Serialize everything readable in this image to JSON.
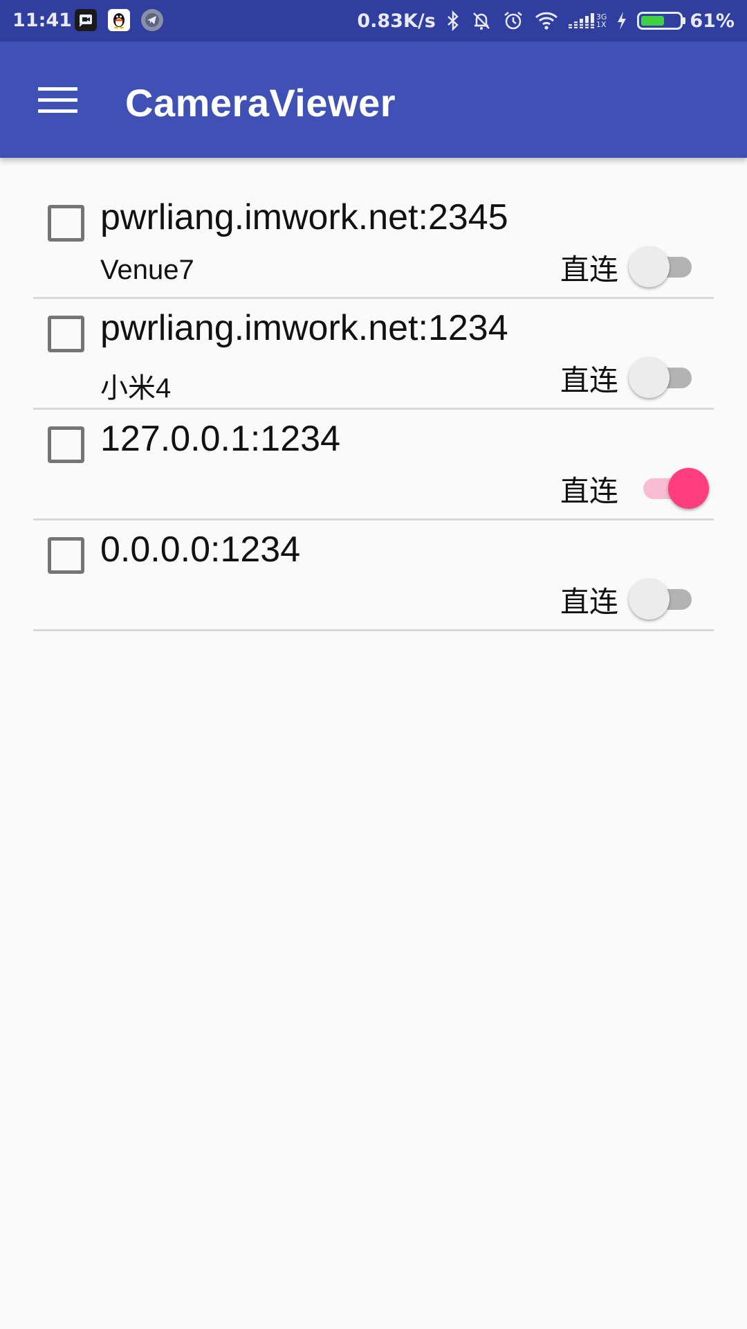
{
  "status_bar": {
    "time": "11:41",
    "notification_icons": [
      "video-message-icon",
      "qq-penguin-icon",
      "telegram-icon"
    ],
    "net_speed": "0.83K/s",
    "status_icons": [
      "bluetooth-icon",
      "bell-off-icon",
      "alarm-icon",
      "wifi-icon",
      "cellular-signal-icon",
      "charging-icon"
    ],
    "network_type_top": "3G",
    "network_type_bottom": "1X",
    "battery_percent": "61%",
    "battery_level": 0.61,
    "battery_color": "#3fd13f"
  },
  "app_bar": {
    "title": "CameraViewer",
    "menu_icon": "hamburger-menu-icon",
    "background_color": "#3f51b5"
  },
  "devices": [
    {
      "address": "pwrliang.imwork.net:2345",
      "name": "Venue7",
      "switch_label": "直连",
      "direct": false,
      "checked": false
    },
    {
      "address": "pwrliang.imwork.net:1234",
      "name": "小米4",
      "switch_label": "直连",
      "direct": false,
      "checked": false
    },
    {
      "address": "127.0.0.1:1234",
      "name": "",
      "switch_label": "直连",
      "direct": true,
      "checked": false
    },
    {
      "address": "0.0.0.0:1234",
      "name": "",
      "switch_label": "直连",
      "direct": false,
      "checked": false
    }
  ],
  "colors": {
    "status_bar": "#303f9f",
    "switch_on": "#ff3d7f",
    "switch_on_track": "#f8bcd3"
  }
}
